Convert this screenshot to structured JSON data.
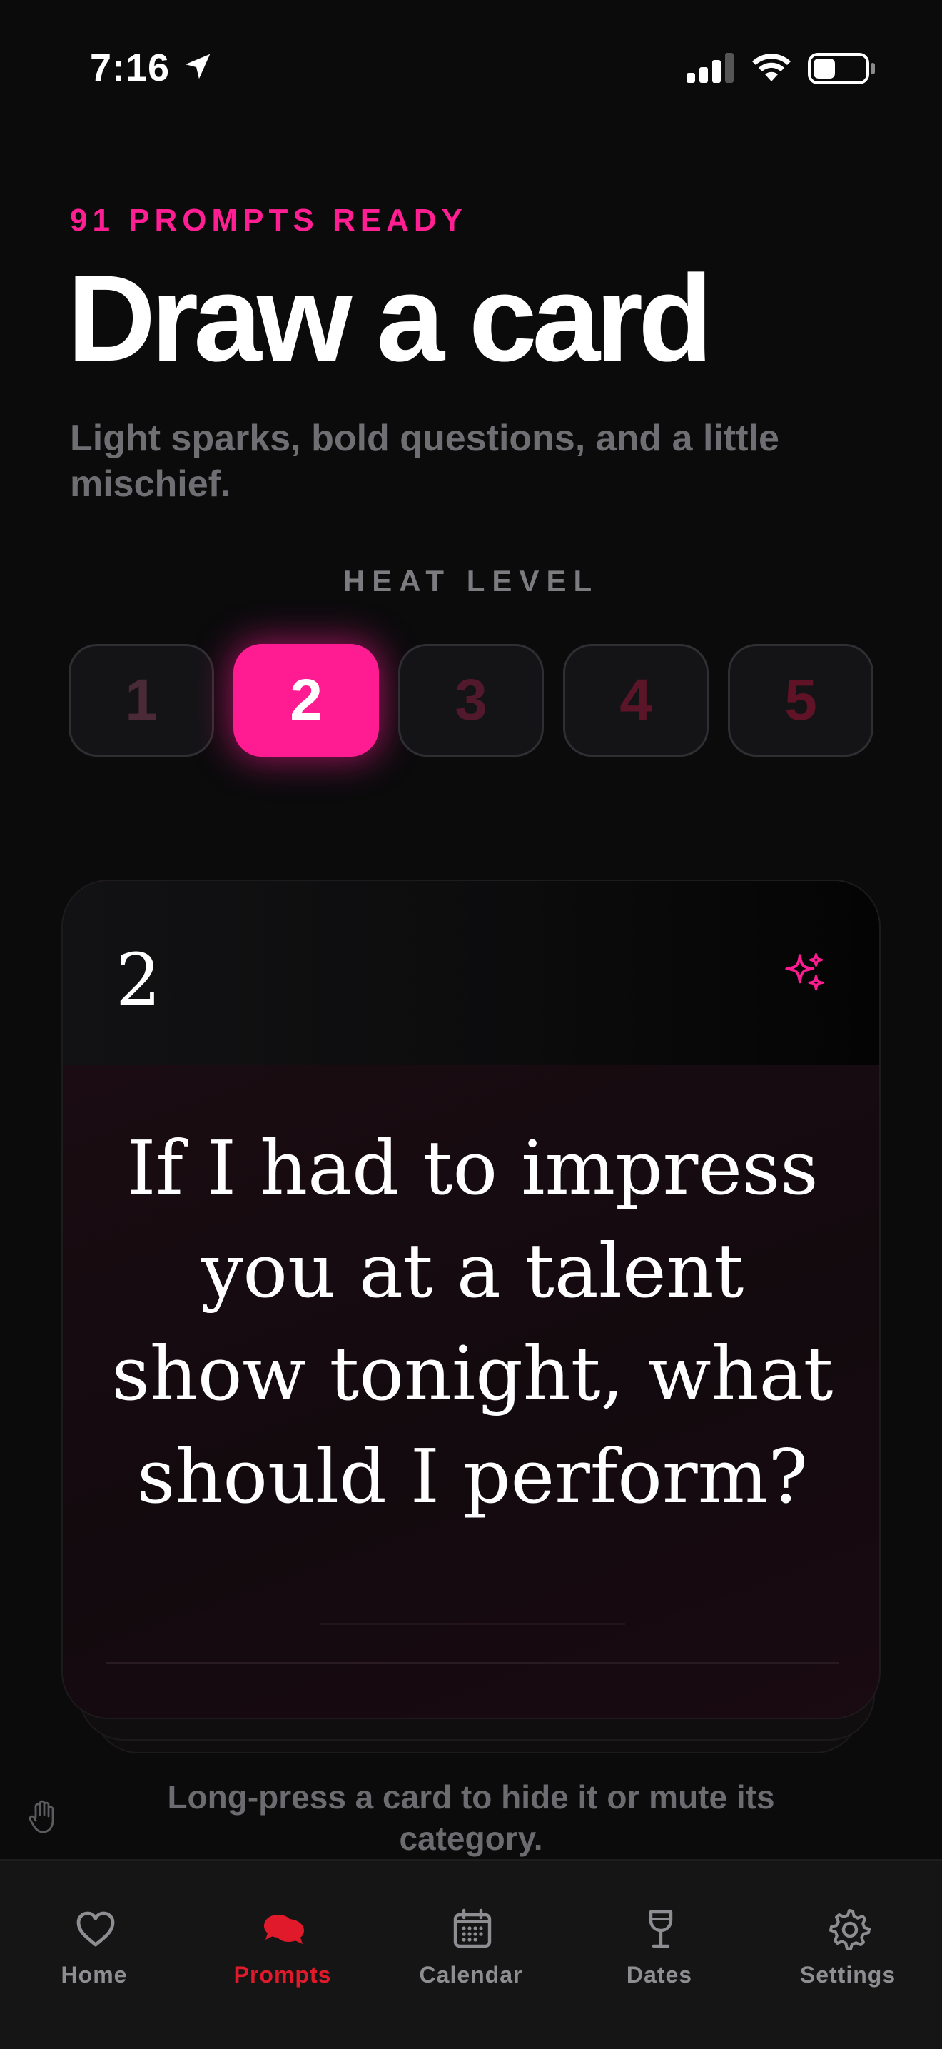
{
  "status_bar": {
    "time": "7:16"
  },
  "header": {
    "eyebrow": "91 PROMPTS READY",
    "title": "Draw a card",
    "subtitle": "Light sparks, bold questions, and a little mischief."
  },
  "heat": {
    "label": "HEAT LEVEL",
    "levels": [
      "1",
      "2",
      "3",
      "4",
      "5"
    ],
    "selected": "2",
    "accent": "#ff1c92"
  },
  "card": {
    "number": "2",
    "prompt": "If I had to impress you at a talent show tonight, what should I perform?"
  },
  "hint": "Long-press a card to hide it or mute its category.",
  "tabs": [
    {
      "label": "Home",
      "icon": "heart-icon"
    },
    {
      "label": "Prompts",
      "icon": "chat-bubbles-icon",
      "active": true
    },
    {
      "label": "Calendar",
      "icon": "calendar-icon"
    },
    {
      "label": "Dates",
      "icon": "wine-glass-icon"
    },
    {
      "label": "Settings",
      "icon": "gear-icon"
    }
  ],
  "colors": {
    "background": "#0b0b0c",
    "accent": "#ff1c92",
    "active_tab": "#e01a2a"
  }
}
